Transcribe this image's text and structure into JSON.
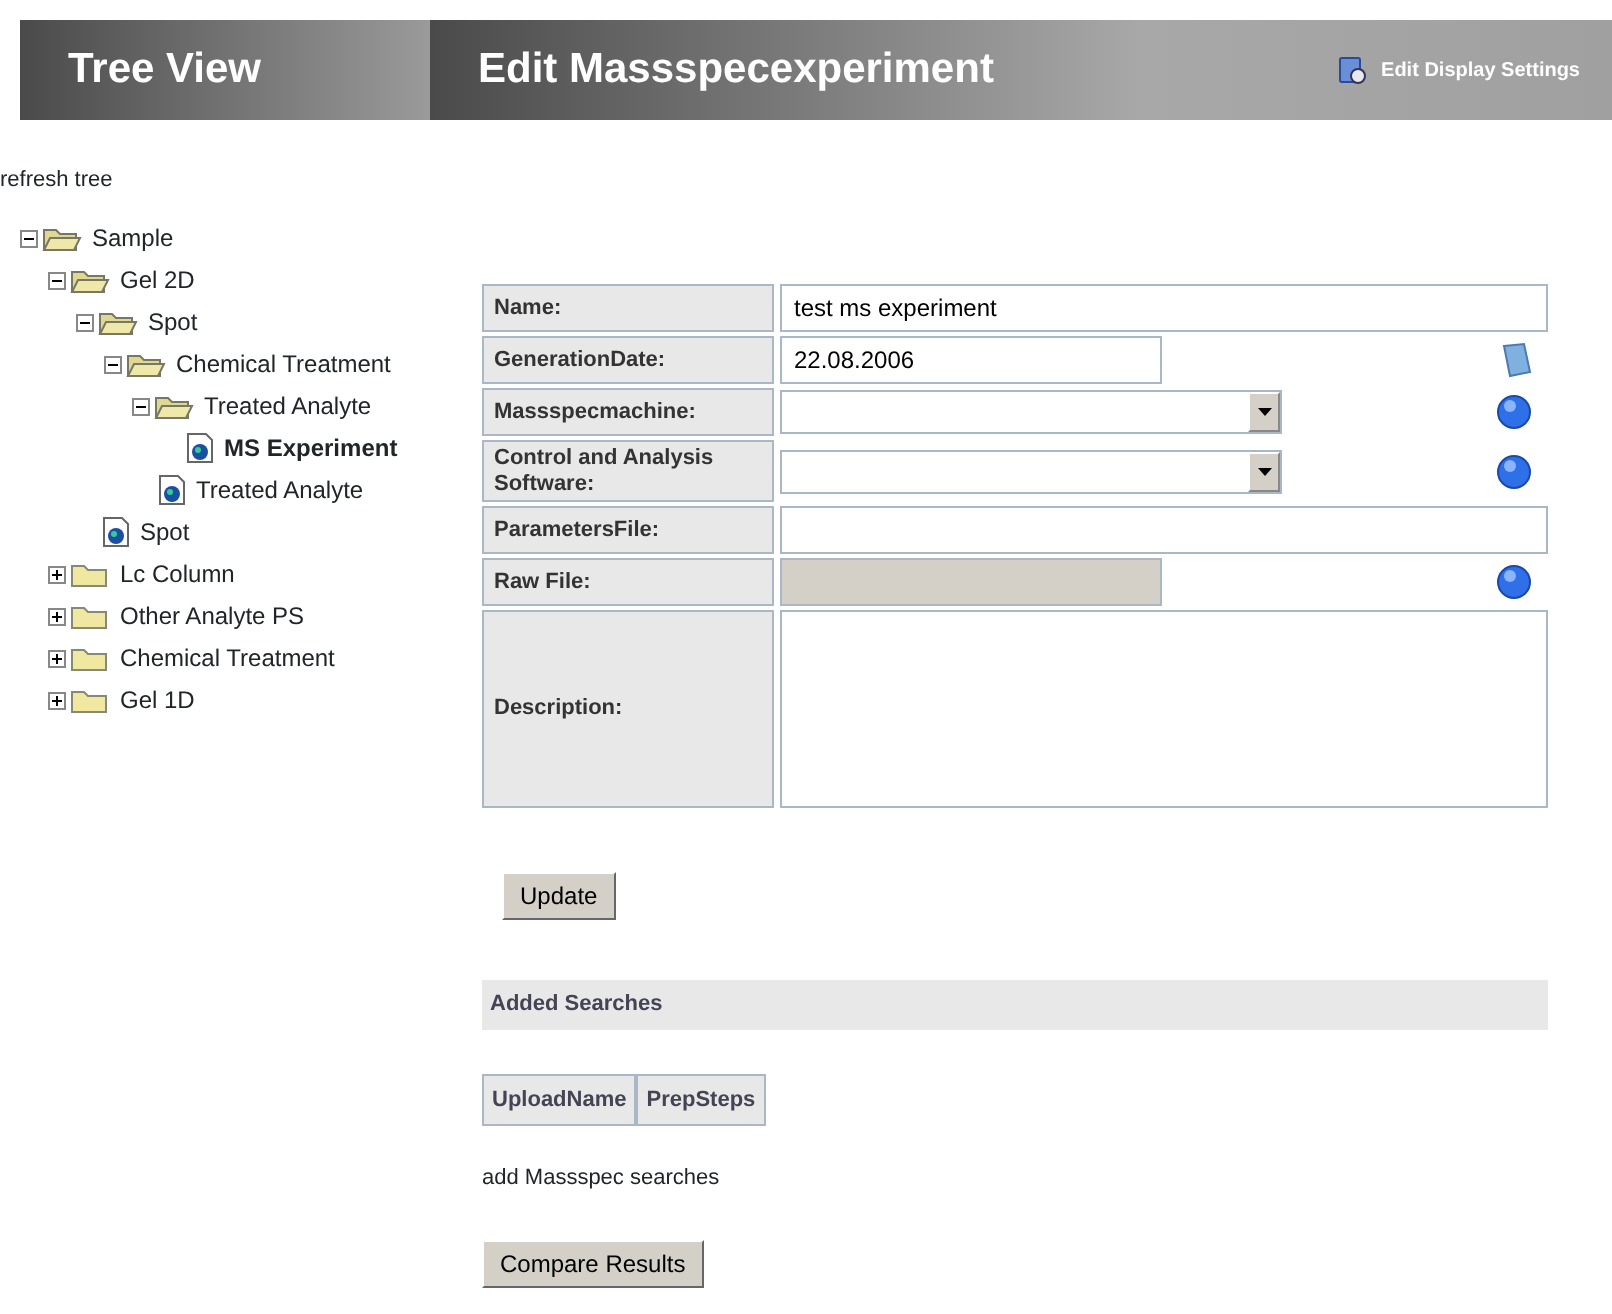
{
  "header": {
    "tree_title": "Tree View",
    "page_title": "Edit Massspecexperiment",
    "settings_link": "Edit Display Settings"
  },
  "refresh_link": "refresh tree",
  "tree": [
    {
      "label": "Sample",
      "kind": "folder",
      "expanded": true,
      "selected": false,
      "children": [
        {
          "label": "Gel 2D",
          "kind": "folder",
          "expanded": true,
          "selected": false,
          "children": [
            {
              "label": "Spot",
              "kind": "folder",
              "expanded": true,
              "selected": false,
              "children": [
                {
                  "label": "Chemical Treatment",
                  "kind": "folder",
                  "expanded": true,
                  "selected": false,
                  "children": [
                    {
                      "label": "Treated Analyte",
                      "kind": "folder",
                      "expanded": true,
                      "selected": false,
                      "children": [
                        {
                          "label": "MS Experiment",
                          "kind": "leaf",
                          "selected": true
                        }
                      ]
                    },
                    {
                      "label": "Treated Analyte",
                      "kind": "leaf",
                      "selected": false
                    }
                  ]
                }
              ]
            },
            {
              "label": "Spot",
              "kind": "leaf",
              "selected": false
            }
          ]
        },
        {
          "label": "Lc Column",
          "kind": "folder",
          "expanded": false,
          "selected": false
        },
        {
          "label": "Other Analyte PS",
          "kind": "folder",
          "expanded": false,
          "selected": false
        },
        {
          "label": "Chemical Treatment",
          "kind": "folder",
          "expanded": false,
          "selected": false
        },
        {
          "label": "Gel 1D",
          "kind": "folder",
          "expanded": false,
          "selected": false
        }
      ]
    }
  ],
  "form": [
    {
      "label": "Name:",
      "field": {
        "kind": "wide_text",
        "value": "test ms experiment"
      }
    },
    {
      "label": "GenerationDate:",
      "field": {
        "kind": "short_text",
        "value": "22.08.2006"
      },
      "button": {
        "kind": "calendar"
      }
    },
    {
      "label": "Massspecmachine:",
      "field": {
        "kind": "select"
      },
      "button": {
        "kind": "lookup"
      }
    },
    {
      "label": "Control and Analysis Software:",
      "field": {
        "kind": "select"
      },
      "button": {
        "kind": "lookup"
      }
    },
    {
      "label": "ParametersFile:",
      "field": {
        "kind": "wide_text"
      }
    },
    {
      "label": "Raw File:",
      "field": {
        "kind": "short_text",
        "disabled": true
      },
      "button": {
        "kind": "lookup"
      }
    },
    {
      "label": "Description:",
      "field": {
        "kind": "textarea"
      }
    }
  ],
  "update_button": "Update",
  "searches_heading": "Added Searches",
  "searches_table": {
    "columns": [
      "UploadName",
      "PrepSteps"
    ]
  },
  "add_link": "add Massspec searches",
  "compare_button": "Compare Results"
}
